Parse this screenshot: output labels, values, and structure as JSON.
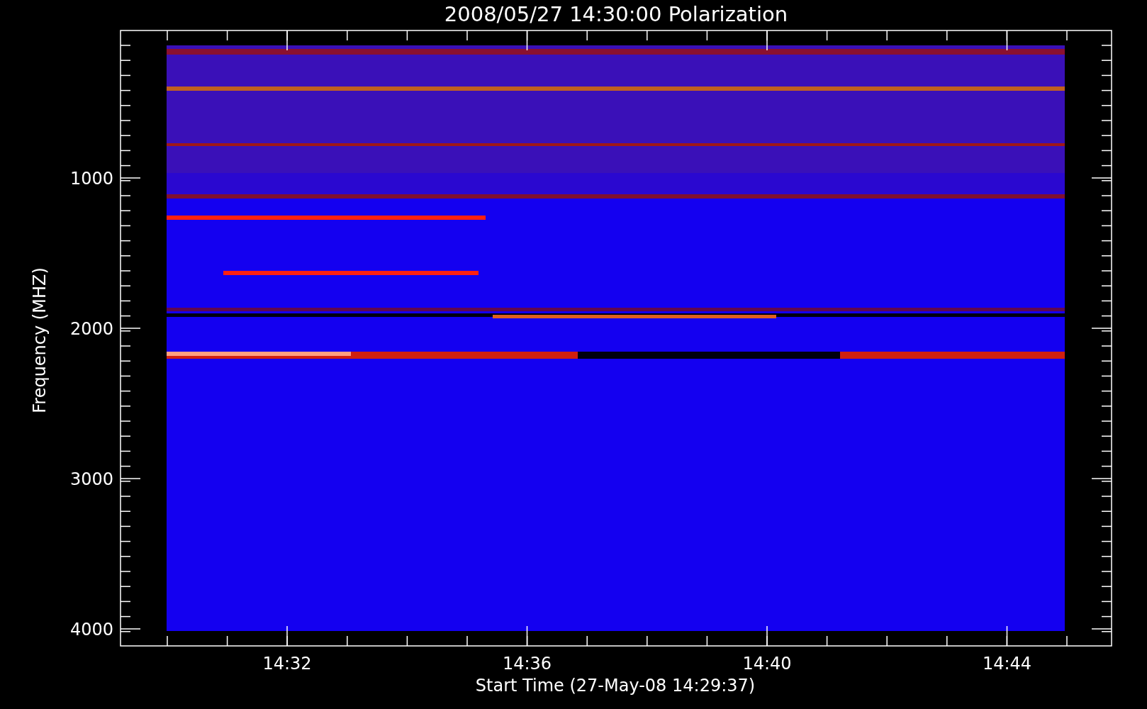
{
  "title": "2008/05/27 14:30:00 Polarization",
  "y_axis": {
    "label": "Frequency (MHZ)",
    "tick_labels": [
      "1000",
      "2000",
      "3000",
      "4000"
    ]
  },
  "x_axis": {
    "label": "Start Time (27-May-08 14:29:37)",
    "tick_labels": [
      "14:32",
      "14:36",
      "14:40",
      "14:44"
    ]
  }
}
